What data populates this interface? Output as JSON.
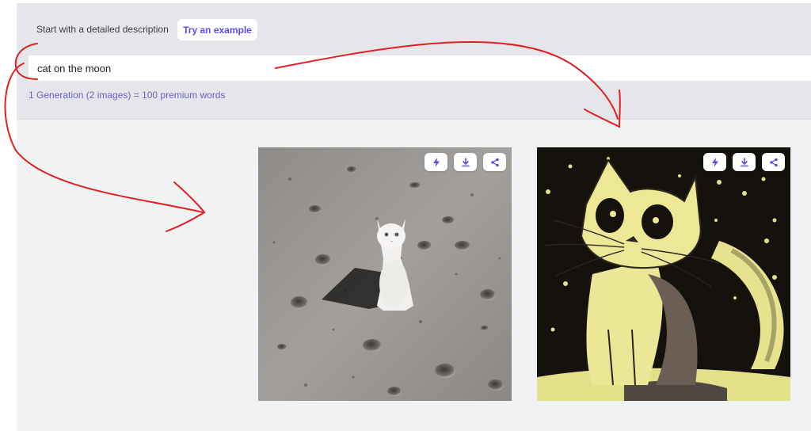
{
  "prompt_section": {
    "hint": "Start with a detailed description",
    "example_button": "Try an example",
    "input_value": "cat on the moon",
    "input_placeholder": "",
    "cost_text": "1 Generation (2 images) = 100 premium words"
  },
  "results": [
    {
      "name": "moon-cat-photo",
      "actions": [
        "bolt-icon",
        "download-icon",
        "share-icon"
      ]
    },
    {
      "name": "moon-cat-illustration",
      "actions": [
        "bolt-icon",
        "download-icon",
        "share-icon"
      ]
    }
  ],
  "colors": {
    "accent": "#5b4ce6",
    "annotation": "#e02020",
    "panel": "#e5e6ea",
    "background": "#f1f2f4"
  }
}
